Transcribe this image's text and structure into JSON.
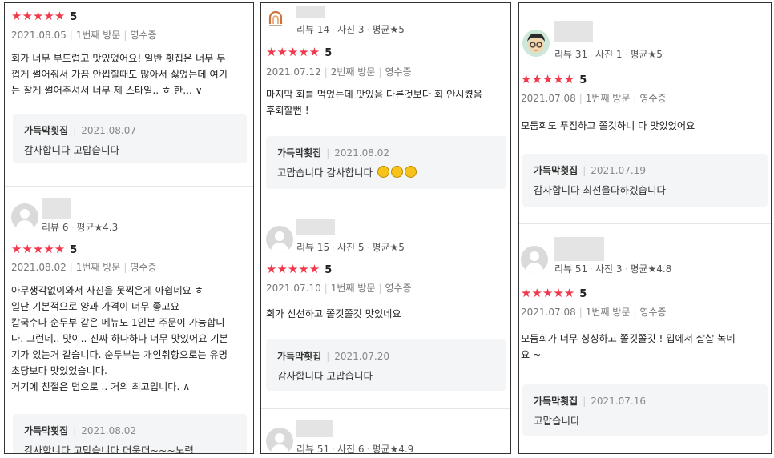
{
  "colors": {
    "star": "#f1394e",
    "reply_bg": "#f3f5f6"
  },
  "panel1": {
    "review1": {
      "stars": "★★★★★",
      "score": "5",
      "date": "2021.08.05",
      "visit": "1번째 방문",
      "receipt": "영수증",
      "lines": [
        "회가 너무 부드럽고 맛있었어요! 일반 횟집은 너무 두",
        "껍게 썰어줘서 가끔 안씹힐때도 많아서 싫었는데 여기",
        "는 잘게 썰어주셔서 너무 제 스타일.. ㅎ 한... ∨"
      ],
      "reply": {
        "name": "가득막횟집",
        "date": "2021.08.07",
        "text": "감사합니다 고맙습니다"
      }
    },
    "review2": {
      "stats": {
        "reviews": "리뷰 6",
        "avg": "평균★4.3"
      },
      "stars": "★★★★★",
      "score": "5",
      "date": "2021.08.02",
      "visit": "1번째 방문",
      "receipt": "영수증",
      "lines": [
        "아무생각없이와서 사진을 못찍은게 아쉽네요 ㅎ",
        "일단 기본적으로 양과 가격이 너무 좋고요",
        "칼국수나 순두부 같은 메뉴도 1인분 주문이 가능합니",
        "다. 그런데.. 맛이.. 진짜 하나하나 너무 맛있어요 기본",
        "기가 있는거 같습니다. 순두부는 개인취향으로는 유명",
        "초당보다 맛있었습니다.",
        "거기에 친절은 덤으로 .. 거의 최고입니다. ∧"
      ],
      "reply": {
        "name": "가득막횟집",
        "date": "2021.08.02",
        "text": "감사합니다 고맙습니다 더욱더~~~노력"
      }
    }
  },
  "panel2": {
    "review1": {
      "stats": {
        "reviews": "리뷰 14",
        "photos": "사진 3",
        "avg": "평균★5"
      },
      "stars": "★★★★★",
      "score": "5",
      "date": "2021.07.12",
      "visit": "2번째 방문",
      "receipt": "영수증",
      "lines": [
        "마지막 회를 먹었는데 맛있음 다른것보다 회 안시켰음",
        "후회할뻔 !"
      ],
      "reply": {
        "name": "가득막횟집",
        "date": "2021.08.02",
        "text": "고맙습니다 감사합니다"
      }
    },
    "review2": {
      "stats": {
        "reviews": "리뷰 15",
        "photos": "사진 5",
        "avg": "평균★5"
      },
      "stars": "★★★★★",
      "score": "5",
      "date": "2021.07.10",
      "visit": "1번째 방문",
      "receipt": "영수증",
      "lines": [
        "회가 신선하고 쫄깃쫄깃 맛있네요"
      ],
      "reply": {
        "name": "가득막횟집",
        "date": "2021.07.20",
        "text": "감사합니다 고맙습니다"
      }
    },
    "review3": {
      "stats": {
        "reviews": "리뷰 51",
        "photos": "사진 6",
        "avg": "평균★4.9"
      }
    }
  },
  "panel3": {
    "review1": {
      "stats": {
        "reviews": "리뷰 31",
        "photos": "사진 1",
        "avg": "평균★5"
      },
      "stars": "★★★★★",
      "score": "5",
      "date": "2021.07.08",
      "visit": "1번째 방문",
      "receipt": "영수증",
      "lines": [
        "모둠회도 푸짐하고 쫄깃하니 다 맛있었어요"
      ],
      "reply": {
        "name": "가득막횟집",
        "date": "2021.07.19",
        "text": "감사합니다 최선을다하겠습니다"
      }
    },
    "review2": {
      "stats": {
        "reviews": "리뷰 51",
        "photos": "사진 3",
        "avg": "평균★4.8"
      },
      "stars": "★★★★★",
      "score": "5",
      "date": "2021.07.08",
      "visit": "1번째 방문",
      "receipt": "영수증",
      "lines": [
        "모둠회가 너무 싱싱하고 쫄깃쫄깃 ! 입에서 살살 녹네",
        "요 ~"
      ],
      "reply": {
        "name": "가득막횟집",
        "date": "2021.07.16",
        "text": "고맙습니다"
      }
    }
  }
}
